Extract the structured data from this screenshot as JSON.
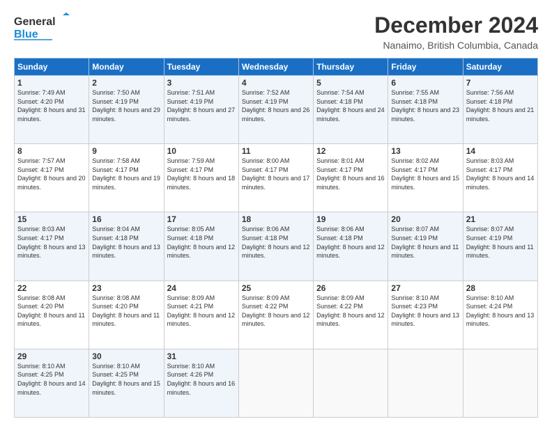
{
  "header": {
    "logo_general": "General",
    "logo_blue": "Blue",
    "title": "December 2024",
    "subtitle": "Nanaimo, British Columbia, Canada"
  },
  "calendar": {
    "days_of_week": [
      "Sunday",
      "Monday",
      "Tuesday",
      "Wednesday",
      "Thursday",
      "Friday",
      "Saturday"
    ],
    "weeks": [
      [
        {
          "day": "1",
          "sunrise": "7:49 AM",
          "sunset": "4:20 PM",
          "daylight": "8 hours and 31 minutes."
        },
        {
          "day": "2",
          "sunrise": "7:50 AM",
          "sunset": "4:19 PM",
          "daylight": "8 hours and 29 minutes."
        },
        {
          "day": "3",
          "sunrise": "7:51 AM",
          "sunset": "4:19 PM",
          "daylight": "8 hours and 27 minutes."
        },
        {
          "day": "4",
          "sunrise": "7:52 AM",
          "sunset": "4:19 PM",
          "daylight": "8 hours and 26 minutes."
        },
        {
          "day": "5",
          "sunrise": "7:54 AM",
          "sunset": "4:18 PM",
          "daylight": "8 hours and 24 minutes."
        },
        {
          "day": "6",
          "sunrise": "7:55 AM",
          "sunset": "4:18 PM",
          "daylight": "8 hours and 23 minutes."
        },
        {
          "day": "7",
          "sunrise": "7:56 AM",
          "sunset": "4:18 PM",
          "daylight": "8 hours and 21 minutes."
        }
      ],
      [
        {
          "day": "8",
          "sunrise": "7:57 AM",
          "sunset": "4:17 PM",
          "daylight": "8 hours and 20 minutes."
        },
        {
          "day": "9",
          "sunrise": "7:58 AM",
          "sunset": "4:17 PM",
          "daylight": "8 hours and 19 minutes."
        },
        {
          "day": "10",
          "sunrise": "7:59 AM",
          "sunset": "4:17 PM",
          "daylight": "8 hours and 18 minutes."
        },
        {
          "day": "11",
          "sunrise": "8:00 AM",
          "sunset": "4:17 PM",
          "daylight": "8 hours and 17 minutes."
        },
        {
          "day": "12",
          "sunrise": "8:01 AM",
          "sunset": "4:17 PM",
          "daylight": "8 hours and 16 minutes."
        },
        {
          "day": "13",
          "sunrise": "8:02 AM",
          "sunset": "4:17 PM",
          "daylight": "8 hours and 15 minutes."
        },
        {
          "day": "14",
          "sunrise": "8:03 AM",
          "sunset": "4:17 PM",
          "daylight": "8 hours and 14 minutes."
        }
      ],
      [
        {
          "day": "15",
          "sunrise": "8:03 AM",
          "sunset": "4:17 PM",
          "daylight": "8 hours and 13 minutes."
        },
        {
          "day": "16",
          "sunrise": "8:04 AM",
          "sunset": "4:18 PM",
          "daylight": "8 hours and 13 minutes."
        },
        {
          "day": "17",
          "sunrise": "8:05 AM",
          "sunset": "4:18 PM",
          "daylight": "8 hours and 12 minutes."
        },
        {
          "day": "18",
          "sunrise": "8:06 AM",
          "sunset": "4:18 PM",
          "daylight": "8 hours and 12 minutes."
        },
        {
          "day": "19",
          "sunrise": "8:06 AM",
          "sunset": "4:18 PM",
          "daylight": "8 hours and 12 minutes."
        },
        {
          "day": "20",
          "sunrise": "8:07 AM",
          "sunset": "4:19 PM",
          "daylight": "8 hours and 11 minutes."
        },
        {
          "day": "21",
          "sunrise": "8:07 AM",
          "sunset": "4:19 PM",
          "daylight": "8 hours and 11 minutes."
        }
      ],
      [
        {
          "day": "22",
          "sunrise": "8:08 AM",
          "sunset": "4:20 PM",
          "daylight": "8 hours and 11 minutes."
        },
        {
          "day": "23",
          "sunrise": "8:08 AM",
          "sunset": "4:20 PM",
          "daylight": "8 hours and 11 minutes."
        },
        {
          "day": "24",
          "sunrise": "8:09 AM",
          "sunset": "4:21 PM",
          "daylight": "8 hours and 12 minutes."
        },
        {
          "day": "25",
          "sunrise": "8:09 AM",
          "sunset": "4:22 PM",
          "daylight": "8 hours and 12 minutes."
        },
        {
          "day": "26",
          "sunrise": "8:09 AM",
          "sunset": "4:22 PM",
          "daylight": "8 hours and 12 minutes."
        },
        {
          "day": "27",
          "sunrise": "8:10 AM",
          "sunset": "4:23 PM",
          "daylight": "8 hours and 13 minutes."
        },
        {
          "day": "28",
          "sunrise": "8:10 AM",
          "sunset": "4:24 PM",
          "daylight": "8 hours and 13 minutes."
        }
      ],
      [
        {
          "day": "29",
          "sunrise": "8:10 AM",
          "sunset": "4:25 PM",
          "daylight": "8 hours and 14 minutes."
        },
        {
          "day": "30",
          "sunrise": "8:10 AM",
          "sunset": "4:25 PM",
          "daylight": "8 hours and 15 minutes."
        },
        {
          "day": "31",
          "sunrise": "8:10 AM",
          "sunset": "4:26 PM",
          "daylight": "8 hours and 16 minutes."
        },
        null,
        null,
        null,
        null
      ]
    ]
  }
}
